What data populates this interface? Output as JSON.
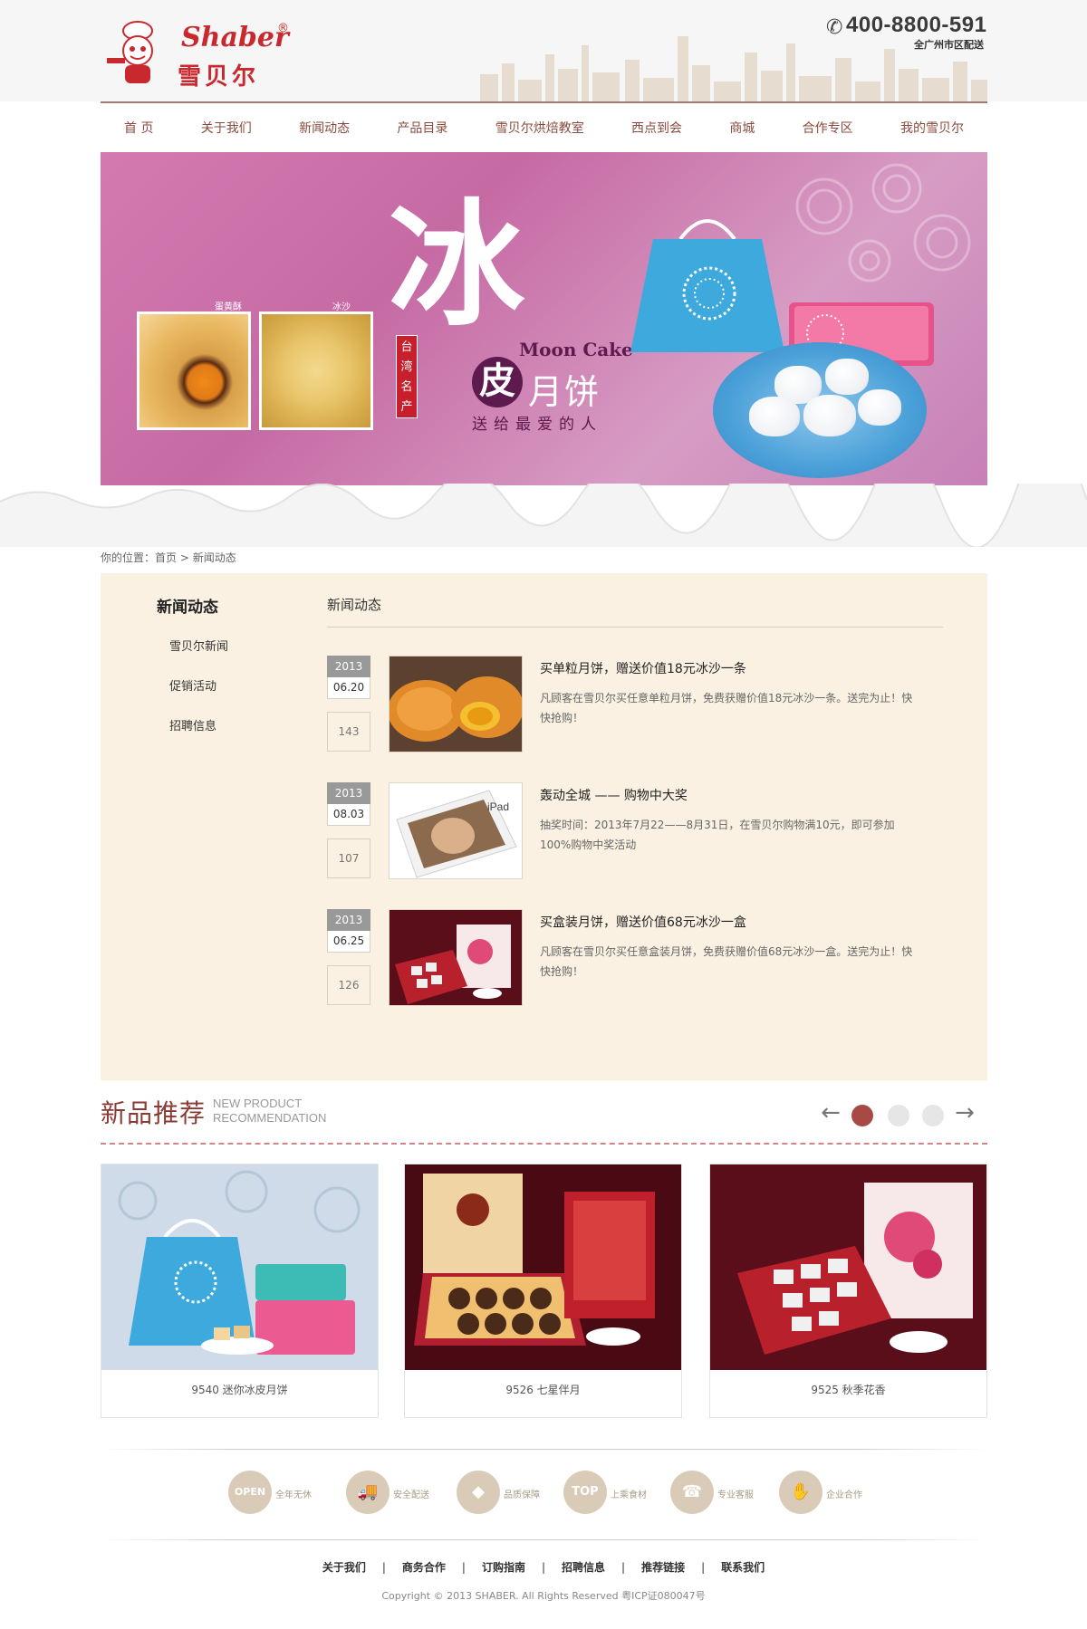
{
  "header": {
    "logo_en": "Shaber",
    "logo_reg": "®",
    "logo_cn": "雪贝尔",
    "phone": "400-8800-591",
    "phone_sub": "全广州市区配送"
  },
  "nav": {
    "items": [
      "首 页",
      "关于我们",
      "新闻动态",
      "产品目录",
      "雪贝尔烘焙教室",
      "西点到会",
      "商城",
      "合作专区",
      "我的雪贝尔"
    ]
  },
  "banner": {
    "photo1_label": "蛋黄酥",
    "photo2_label": "冰沙",
    "big_char": "冰",
    "seal_text": "台湾名产",
    "moon_cake_en": "Moon Cake",
    "pi_char": "皮",
    "yuebing": "月饼",
    "slogan": "送给最爱的人"
  },
  "breadcrumb": {
    "prefix": "你的位置：",
    "home": "首页",
    "separator": " > ",
    "current": "新闻动态"
  },
  "sidebar": {
    "title": "新闻动态",
    "items": [
      "雪贝尔新闻",
      "促销活动",
      "招聘信息"
    ]
  },
  "main": {
    "title": "新闻动态",
    "news": [
      {
        "year": "2013",
        "date": "06.20",
        "count": "143",
        "title": "买单粒月饼，赠送价值18元冰沙一条",
        "desc": "凡顾客在雪贝尔买任意单粒月饼，免费获赠价值18元冰沙一条。送完为止！快快抢购！"
      },
      {
        "year": "2013",
        "date": "08.03",
        "count": "107",
        "title": "轰动全城 —— 购物中大奖",
        "desc": "抽奖时间：2013年7月22——8月31日，在雪贝尔购物满10元，即可参加100%购物中奖活动"
      },
      {
        "year": "2013",
        "date": "06.25",
        "count": "126",
        "title": "买盒装月饼，赠送价值68元冰沙一盒",
        "desc": "凡顾客在雪贝尔买任意盒装月饼，免费获赠价值68元冰沙一盒。送完为止！快快抢购！"
      }
    ]
  },
  "new_products": {
    "title_cn": "新品推荐",
    "title_en_1": "NEW PRODUCT",
    "title_en_2": "RECOMMENDATION",
    "prev_icon": "←",
    "next_icon": "→",
    "products": [
      {
        "name": "9540 迷你冰皮月饼"
      },
      {
        "name": "9526 七星伴月"
      },
      {
        "name": "9525 秋季花香"
      }
    ]
  },
  "features": [
    {
      "icon": "open-icon",
      "icon_text": "OPEN",
      "label": "全年无休"
    },
    {
      "icon": "truck-icon",
      "icon_text": "🚚",
      "label": "安全配送"
    },
    {
      "icon": "shield-icon",
      "icon_text": "◆",
      "label": "品质保障"
    },
    {
      "icon": "top-icon",
      "icon_text": "TOP",
      "label": "上乘食材"
    },
    {
      "icon": "headset-icon",
      "icon_text": "☎",
      "label": "专业客服"
    },
    {
      "icon": "handshake-icon",
      "icon_text": "✋",
      "label": "企业合作"
    }
  ],
  "footer": {
    "links": [
      "关于我们",
      "商务合作",
      "订购指南",
      "招聘信息",
      "推荐链接",
      "联系我们"
    ],
    "separator": "|",
    "copyright": "Copyright © 2013 SHABER. All Rights Reserved 粤ICP证080047号"
  },
  "colors": {
    "brand_red": "#c8282e",
    "nav_text": "#8b4a3e",
    "panel_bg": "#fbf1e2",
    "accent_dot": "#a84a44"
  }
}
